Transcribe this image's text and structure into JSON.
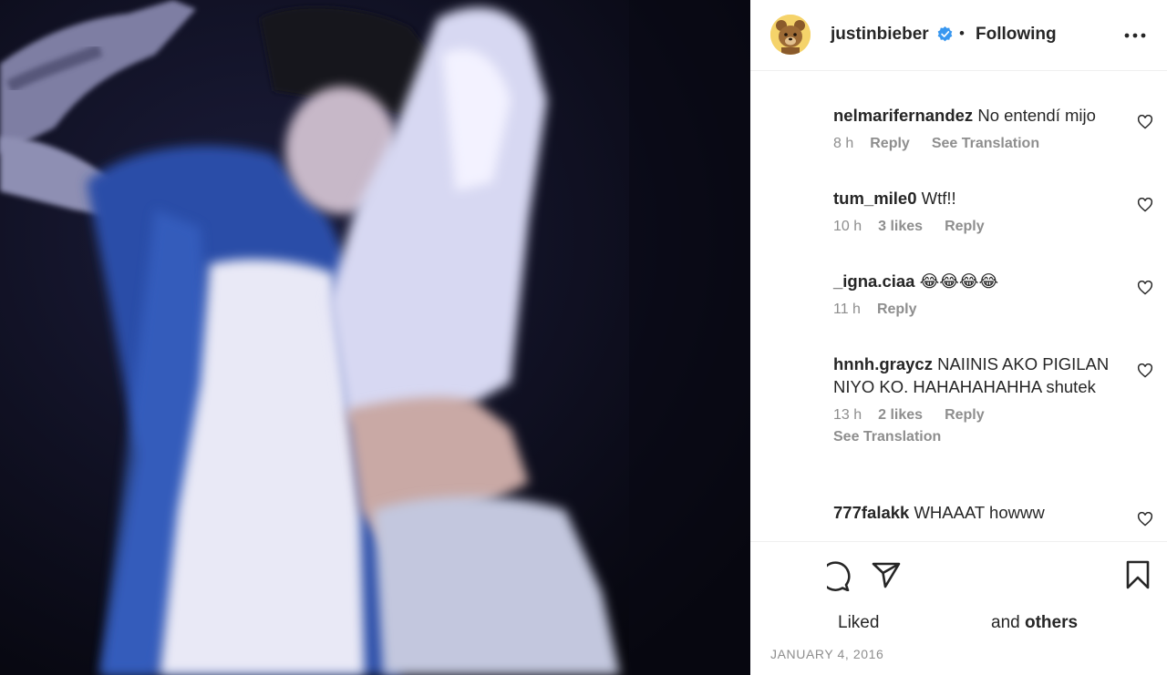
{
  "header": {
    "username": "justinbieber",
    "separator": "•",
    "follow_status": "Following"
  },
  "comments": [
    {
      "username": "nelmarifernandez",
      "text": "No entendí mijo",
      "time": "8 h",
      "likes": "",
      "reply": "Reply",
      "translation": "See Translation",
      "translation_below": ""
    },
    {
      "username": "tum_mile0",
      "text": "Wtf!!",
      "time": "10 h",
      "likes": "3 likes",
      "reply": "Reply",
      "translation": "",
      "translation_below": ""
    },
    {
      "username": "_igna.ciaa",
      "text": "😂😂😂😂",
      "time": "11 h",
      "likes": "",
      "reply": "Reply",
      "translation": "",
      "translation_below": ""
    },
    {
      "username": "hnnh.graycz",
      "text": "NAIINIS AKO PIGILAN NIYO KO. HAHAHAHAHHA shutek",
      "time": "13 h",
      "likes": "2 likes",
      "reply": "Reply",
      "translation": "",
      "translation_below": "See Translation"
    },
    {
      "username": "777falakk",
      "text": "WHAAAT howww",
      "time": "",
      "likes": "",
      "reply": "",
      "translation": "",
      "translation_below": ""
    }
  ],
  "actions": {
    "liked_label": "Liked",
    "and_label": "and",
    "others_label": "others",
    "date": "JANUARY 4, 2016"
  },
  "colors": {
    "verified": "#3897f0",
    "secondary_text": "#8e8e8e",
    "primary_text": "#262626",
    "divider": "#efefef"
  },
  "icons": [
    "verified-badge-icon",
    "more-options-icon",
    "heart-icon",
    "comment-icon",
    "share-icon",
    "bookmark-icon",
    "teddy-bear-avatar"
  ]
}
